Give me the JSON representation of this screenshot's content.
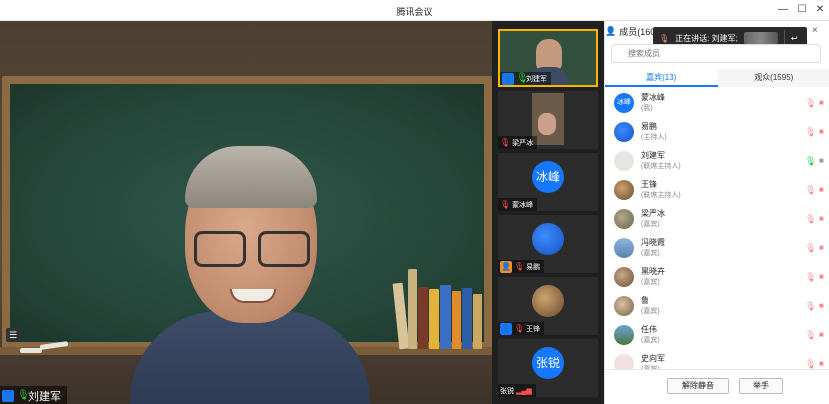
{
  "window": {
    "title": "腾讯会议",
    "minimize": "—",
    "maximize": "☐",
    "close": "✕"
  },
  "main_video": {
    "speaker_name": "刘建军"
  },
  "thumbnails": [
    {
      "name": "刘建军",
      "active": true
    },
    {
      "name": "梁严冰"
    },
    {
      "name": "蒙冰峰",
      "avatar_text": "冰峰"
    },
    {
      "name": "易鹏"
    },
    {
      "name": "王锋"
    },
    {
      "name": "张锐",
      "avatar_text": "张锐"
    }
  ],
  "panel": {
    "title": "成员(1608",
    "close": "×",
    "search_placeholder": "搜索成员",
    "speaking_text": "正在讲话: 刘建军;",
    "tabs": [
      {
        "label": "嘉宾(13)",
        "active": true
      },
      {
        "label": "观众(1595)"
      }
    ],
    "members": [
      {
        "name": "蒙冰峰",
        "role": "(我)",
        "avatar_text": "冰峰",
        "mic": "muted"
      },
      {
        "name": "易鹏",
        "role": "(主持人)",
        "avatar_text": "",
        "mic": "muted"
      },
      {
        "name": "刘建军",
        "role": "(联席主持人)",
        "avatar_text": "",
        "mic": "active"
      },
      {
        "name": "王锋",
        "role": "(联席主持人)",
        "avatar_text": "",
        "mic": "muted"
      },
      {
        "name": "梁严冰",
        "role": "(嘉宾)",
        "avatar_text": "",
        "mic": "muted"
      },
      {
        "name": "冯晓霞",
        "role": "(嘉宾)",
        "avatar_text": "",
        "mic": "muted"
      },
      {
        "name": "黑晓卉",
        "role": "(嘉宾)",
        "avatar_text": "",
        "mic": "muted"
      },
      {
        "name": "鲁",
        "role": "(嘉宾)",
        "avatar_text": "",
        "mic": "muted"
      },
      {
        "name": "任伟",
        "role": "(嘉宾)",
        "avatar_text": "",
        "mic": "muted"
      },
      {
        "name": "史向军",
        "role": "(嘉宾)",
        "avatar_text": "",
        "mic": "muted"
      }
    ],
    "unmute_all": "解除静音",
    "raise_hand": "举手"
  }
}
